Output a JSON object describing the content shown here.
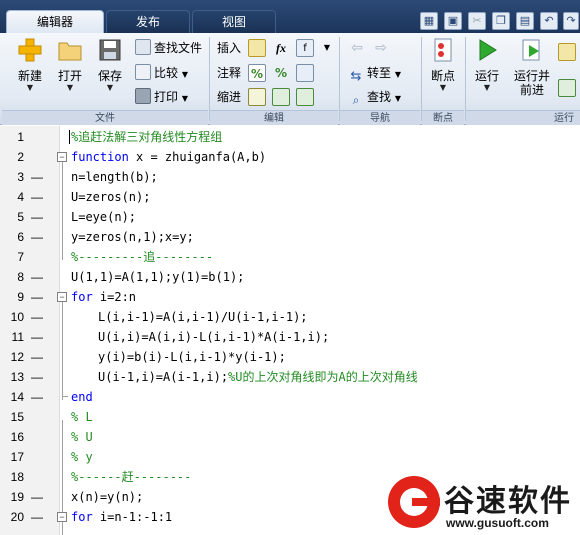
{
  "tabs": [
    {
      "label": "编辑器",
      "active": true
    },
    {
      "label": "发布",
      "active": false
    },
    {
      "label": "视图",
      "active": false
    }
  ],
  "ribbon": {
    "file": {
      "new_label": "新建",
      "open_label": "打开",
      "save_label": "保存",
      "find_files_label": "查找文件",
      "compare_label": "比较",
      "print_label": "打印",
      "group_label": "文件"
    },
    "edit": {
      "insert_label": "插入",
      "comment_label": "注释",
      "indent_label": "缩进",
      "fx_label": "fx",
      "percent_label": "%",
      "group_label": "编辑"
    },
    "navigate": {
      "goto_label": "转至",
      "find_label": "查找",
      "group_label": "导航"
    },
    "breakpoints": {
      "breakpoint_label": "断点",
      "group_label": "断点"
    },
    "run": {
      "run_label": "运行",
      "run_advance_label_1": "运行并",
      "run_advance_label_2": "前进",
      "group_label": "运行"
    }
  },
  "editor": {
    "lines": [
      {
        "n": "1",
        "dash": "",
        "fold": "",
        "kind": "comment",
        "text": "%追赶法解三对角线性方程组"
      },
      {
        "n": "2",
        "dash": "",
        "fold": "minus",
        "kind": "func",
        "kw": "function",
        "text": " x = zhuiganfa(A,b)"
      },
      {
        "n": "3",
        "dash": "—",
        "fold": "",
        "kind": "plain",
        "text": "n=length(b);"
      },
      {
        "n": "4",
        "dash": "—",
        "fold": "",
        "kind": "plain",
        "text": "U=zeros(n);"
      },
      {
        "n": "5",
        "dash": "—",
        "fold": "",
        "kind": "plain",
        "text": "L=eye(n);"
      },
      {
        "n": "6",
        "dash": "—",
        "fold": "",
        "kind": "plain",
        "text": "y=zeros(n,1);x=y;"
      },
      {
        "n": "7",
        "dash": "",
        "fold": "",
        "kind": "comment",
        "text": "%---------追--------"
      },
      {
        "n": "8",
        "dash": "—",
        "fold": "",
        "kind": "plain",
        "text": "U(1,1)=A(1,1);y(1)=b(1);"
      },
      {
        "n": "9",
        "dash": "—",
        "fold": "minus",
        "kind": "for",
        "kw": "for",
        "text": " i=2:n"
      },
      {
        "n": "10",
        "dash": "—",
        "fold": "",
        "kind": "plain",
        "indent": true,
        "text": "L(i,i-1)=A(i,i-1)/U(i-1,i-1);"
      },
      {
        "n": "11",
        "dash": "—",
        "fold": "",
        "kind": "plain",
        "indent": true,
        "text": "U(i,i)=A(i,i)-L(i,i-1)*A(i-1,i);"
      },
      {
        "n": "12",
        "dash": "—",
        "fold": "",
        "kind": "plain",
        "indent": true,
        "text": "y(i)=b(i)-L(i,i-1)*y(i-1);"
      },
      {
        "n": "13",
        "dash": "—",
        "fold": "",
        "kind": "mixed",
        "indent": true,
        "text": "U(i-1,i)=A(i-1,i);",
        "comment": "%U的上次对角线即为A的上次对角线"
      },
      {
        "n": "14",
        "dash": "—",
        "fold": "end",
        "kind": "end",
        "kw": "end",
        "text": ""
      },
      {
        "n": "15",
        "dash": "",
        "fold": "",
        "kind": "comment",
        "text": "% L"
      },
      {
        "n": "16",
        "dash": "",
        "fold": "",
        "kind": "comment",
        "text": "% U"
      },
      {
        "n": "17",
        "dash": "",
        "fold": "",
        "kind": "comment",
        "text": "% y"
      },
      {
        "n": "18",
        "dash": "",
        "fold": "",
        "kind": "comment",
        "text": "%------赶--------"
      },
      {
        "n": "19",
        "dash": "—",
        "fold": "",
        "kind": "plain",
        "text": "x(n)=y(n);"
      },
      {
        "n": "20",
        "dash": "—",
        "fold": "minus",
        "kind": "for",
        "kw": "for",
        "text": " i=n-1:-1:1"
      }
    ]
  },
  "watermark": {
    "title": "谷速软件",
    "url": "www.gusuoft.com"
  },
  "colors": {
    "keyword": "#0000ff",
    "comment": "#228b22",
    "tab_bar": "#1c355c",
    "watermark_red": "#e2231a"
  }
}
